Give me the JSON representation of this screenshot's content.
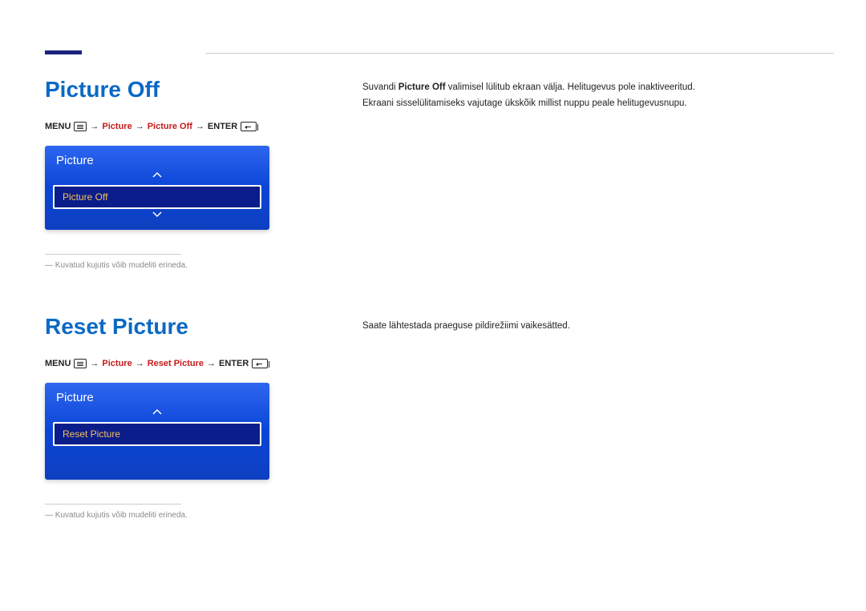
{
  "section1": {
    "title": "Picture Off",
    "path": {
      "menu": "MENU",
      "p1": "Picture",
      "p2": "Picture Off",
      "enter": "ENTER"
    },
    "osd": {
      "header": "Picture",
      "item": "Picture Off"
    },
    "footnote": "Kuvatud kujutis võib mudeliti erineda.",
    "desc_line1a": "Suvandi ",
    "desc_line1b": "Picture Off",
    "desc_line1c": " valimisel lülitub ekraan välja. Helitugevus pole inaktiveeritud.",
    "desc_line2": "Ekraani sisselülitamiseks vajutage ükskõik millist nuppu peale helitugevusnupu."
  },
  "section2": {
    "title": "Reset Picture",
    "path": {
      "menu": "MENU",
      "p1": "Picture",
      "p2": "Reset Picture",
      "enter": "ENTER"
    },
    "osd": {
      "header": "Picture",
      "item": "Reset Picture"
    },
    "footnote": "Kuvatud kujutis võib mudeliti erineda.",
    "desc": "Saate lähtestada praeguse pildirežiimi vaikesätted."
  },
  "arrow": "→"
}
